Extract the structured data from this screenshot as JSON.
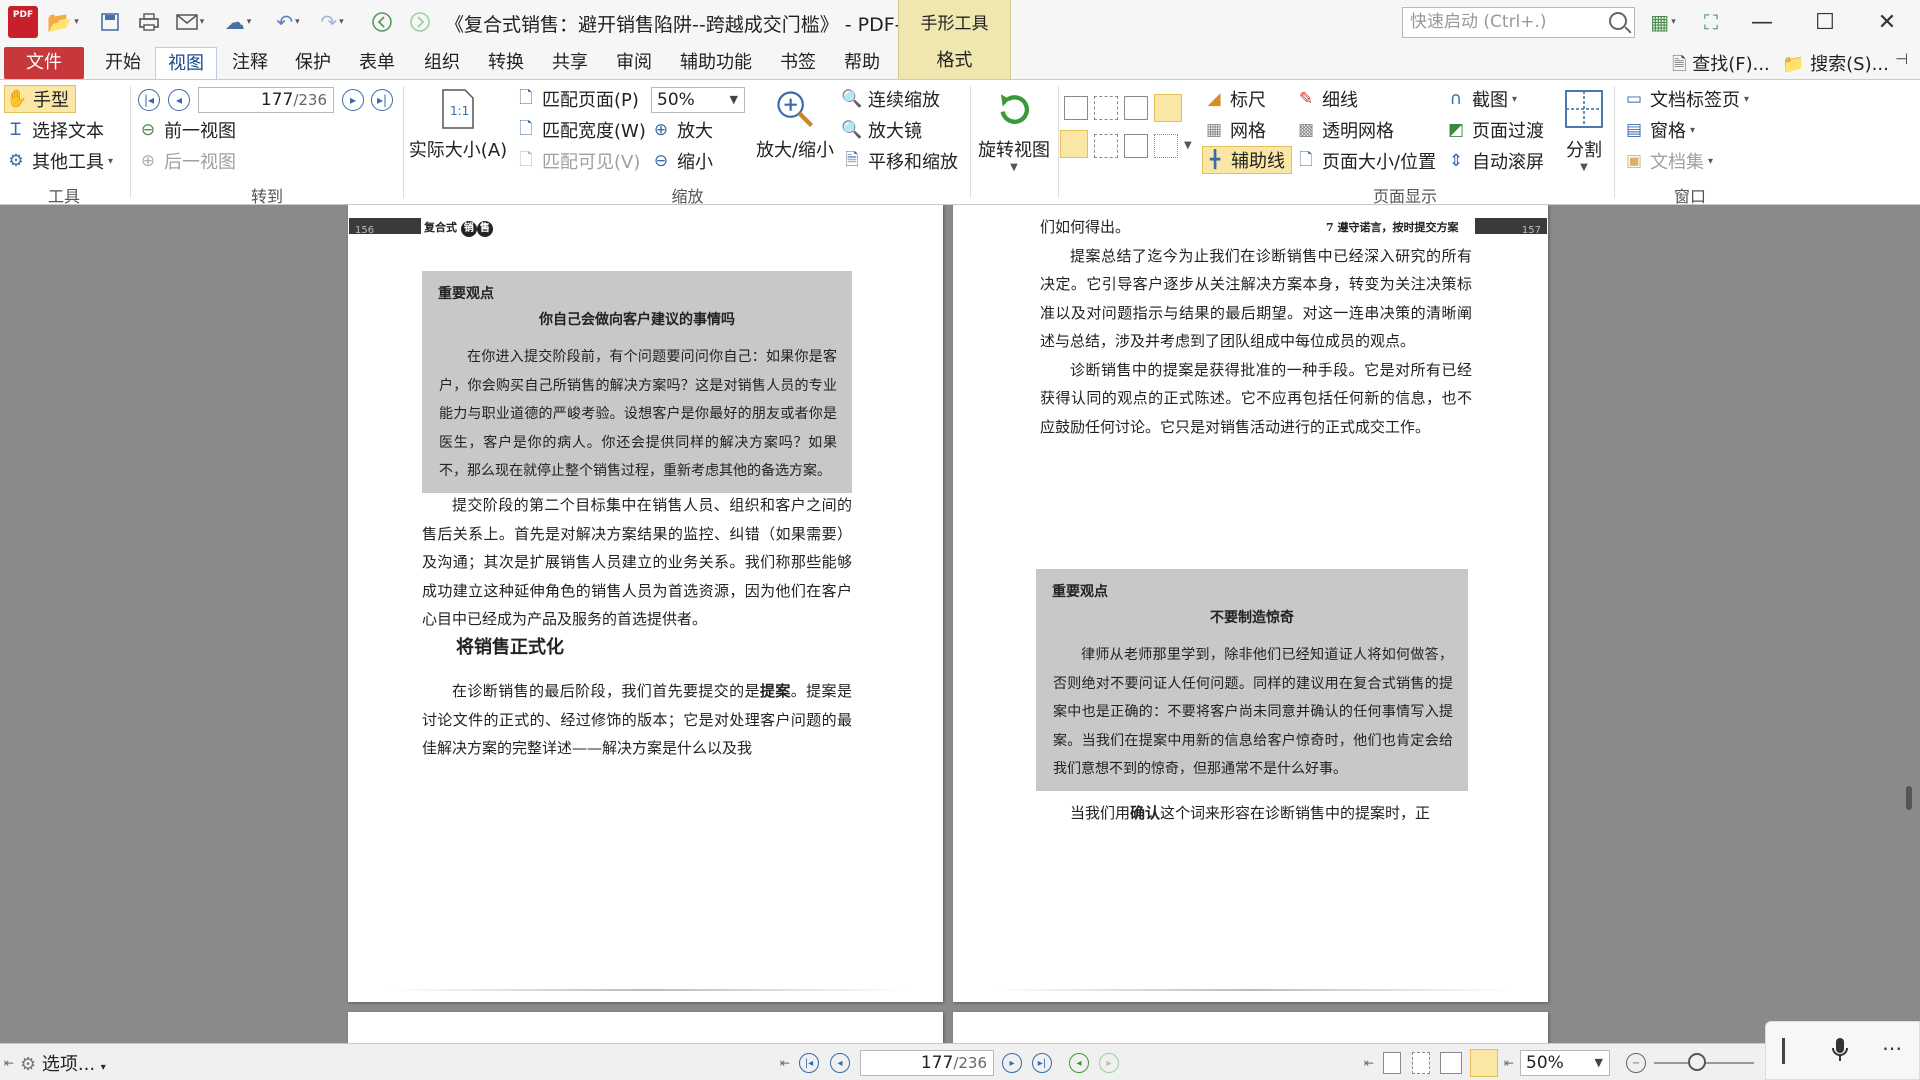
{
  "titlebar": {
    "app_logo": "PDF",
    "document_title": "《复合式销售：避开销售陷阱--跨越成交门槛》 - PDF-...",
    "tool_tab": "手形工具",
    "quick_launch_placeholder": "快速启动 (Ctrl+.)"
  },
  "menu": {
    "file": "文件",
    "tabs": [
      "开始",
      "视图",
      "注释",
      "保护",
      "表单",
      "组织",
      "转换",
      "共享",
      "审阅",
      "辅助功能",
      "书签",
      "帮助"
    ],
    "active_tab": "视图",
    "format_tab": "格式",
    "find": "查找(F)...",
    "search": "搜索(S)..."
  },
  "ribbon": {
    "tools": {
      "hand": "手型",
      "select_text": "选择文本",
      "other_tools": "其他工具",
      "group": "工具"
    },
    "goto": {
      "page_current": "177",
      "page_total": "/236",
      "prev_view": "前一视图",
      "next_view": "后一视图",
      "group": "转到"
    },
    "zoom": {
      "actual_size": "实际大小(A)",
      "fit_page": "匹配页面(P)",
      "fit_width": "匹配宽度(W)",
      "fit_visible": "匹配可见(V)",
      "zoom_value": "50%",
      "zoom_in": "放大",
      "zoom_out": "缩小",
      "zoom_inout": "放大/缩小",
      "continuous_zoom": "连续缩放",
      "magnifier": "放大镜",
      "pan_zoom": "平移和缩放",
      "group": "缩放"
    },
    "rotate": "旋转视图",
    "page_display": {
      "ruler": "标尺",
      "thin_line": "细线",
      "screenshot": "截图",
      "grid": "网格",
      "transparent_grid": "透明网格",
      "page_transition": "页面过渡",
      "guides": "辅助线",
      "page_size_position": "页面大小/位置",
      "auto_scroll": "自动滚屏",
      "split": "分割",
      "group": "页面显示"
    },
    "window": {
      "doc_tabs": "文档标签页",
      "panes": "窗格",
      "doc_set": "文档集",
      "group": "窗口"
    }
  },
  "left_page": {
    "page_number": "156",
    "header_prefix": "复合式",
    "header_badge1": "销",
    "header_badge2": "售",
    "box": {
      "heading": "重要观点",
      "title": "你自己会做向客户建议的事情吗",
      "text": "在你进入提交阶段前，有个问题要问问你自己：如果你是客户，你会购买自己所销售的解决方案吗？这是对销售人员的专业能力与职业道德的严峻考验。设想客户是你最好的朋友或者你是医生，客户是你的病人。你还会提供同样的解决方案吗？如果不，那么现在就停止整个销售过程，重新考虑其他的备选方案。"
    },
    "para1": "提交阶段的第二个目标集中在销售人员、组织和客户之间的售后关系上。首先是对解决方案结果的监控、纠错（如果需要）及沟通；其次是扩展销售人员建立的业务关系。我们称那些能够成功建立这种延伸角色的销售人员为首选资源，因为他们在客户心目中已经成为产品及服务的首选提供者。",
    "section_heading": "将销售正式化",
    "para2_a": "在诊断销售的最后阶段，我们首先要提交的是",
    "para2_bold": "提案",
    "para2_b": "。提案是讨论文件的正式的、经过修饰的版本；它是对处理客户问题的最佳解决方案的完整详述——解决方案是什么以及我"
  },
  "right_page": {
    "page_number": "157",
    "header_text": "7  遵守诺言，按时提交方案",
    "line1": "们如何得出。",
    "para1": "提案总结了迄今为止我们在诊断销售中已经深入研究的所有决定。它引导客户逐步从关注解决方案本身，转变为关注决策标准以及对问题指示与结果的最后期望。对这一连串决策的清晰阐述与总结，涉及并考虑到了团队组成中每位成员的观点。",
    "para2": "诊断销售中的提案是获得批准的一种手段。它是对所有已经获得认同的观点的正式陈述。它不应再包括任何新的信息，也不应鼓励任何讨论。它只是对销售活动进行的正式成交工作。",
    "box": {
      "heading": "重要观点",
      "title": "不要制造惊奇",
      "text": "律师从老师那里学到，除非他们已经知道证人将如何做答，否则绝对不要问证人任何问题。同样的建议用在复合式销售的提案中也是正确的：不要将客户尚未同意并确认的任何事情写入提案。当我们在提案中用新的信息给客户惊奇时，他们也肯定会给我们意想不到的惊奇，但那通常不是什么好事。"
    },
    "para3_a": "当我们用",
    "para3_bold": "确认",
    "para3_b": "这个词来形容在诊断销售中的提案时，正"
  },
  "statusbar": {
    "options": "选项...",
    "page_current": "177",
    "page_total": "/236",
    "zoom_value": "50%"
  },
  "colors": {
    "accent": "#3b6aa8",
    "file_tab": "#c8383a",
    "tool_tab": "#f0e6b0",
    "selected_item": "#fbe7a5",
    "doc_background": "#8a8a8a"
  }
}
